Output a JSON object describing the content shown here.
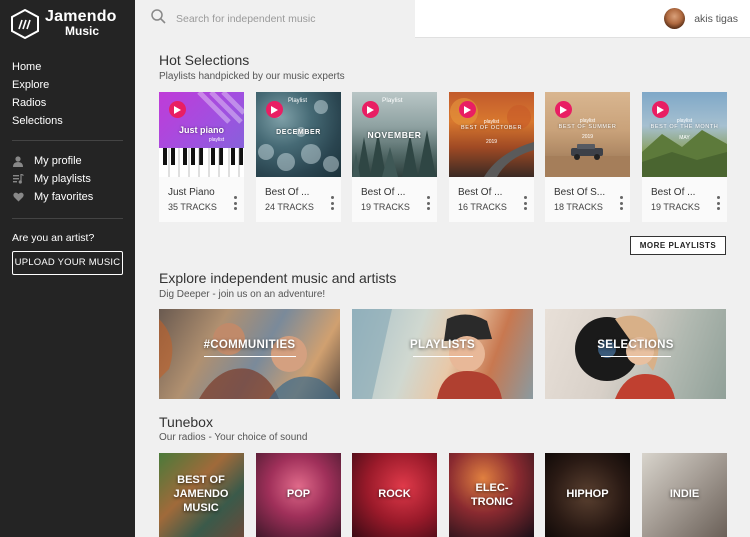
{
  "brand": {
    "line1": "Jamendo",
    "line2": "Music",
    "icon": "jamendo-logo-icon"
  },
  "nav": [
    {
      "label": "Home"
    },
    {
      "label": "Explore"
    },
    {
      "label": "Radios"
    },
    {
      "label": "Selections"
    }
  ],
  "user_nav": [
    {
      "label": "My profile",
      "icon": "person-icon"
    },
    {
      "label": "My playlists",
      "icon": "playlist-icon"
    },
    {
      "label": "My favorites",
      "icon": "heart-icon"
    }
  ],
  "artist": {
    "question": "Are you an artist?",
    "upload_label": "UPLOAD YOUR MUSIC"
  },
  "search": {
    "placeholder": "Search for independent music"
  },
  "user": {
    "name": "akis tigas"
  },
  "hot": {
    "title": "Hot Selections",
    "subtitle": "Playlists handpicked by our music experts",
    "more_label": "MORE PLAYLISTS",
    "playlists": [
      {
        "name": "Just Piano",
        "tracks": "35 TRACKS",
        "cover_top": "",
        "cover_main": "Just piano",
        "cover_sub": "playlist"
      },
      {
        "name": "Best Of ...",
        "tracks": "24 TRACKS",
        "cover_top": "Playlist",
        "cover_main": "DECEMBER",
        "cover_sub": ""
      },
      {
        "name": "Best Of ...",
        "tracks": "19 TRACKS",
        "cover_top": "Playlist",
        "cover_main": "NOVEMBER",
        "cover_sub": ""
      },
      {
        "name": "Best Of ...",
        "tracks": "16 TRACKS",
        "cover_top": "playlist",
        "cover_main": "BEST OF OCTOBER",
        "cover_sub": "2019"
      },
      {
        "name": "Best Of S...",
        "tracks": "18 TRACKS",
        "cover_top": "playlist",
        "cover_main": "BEST OF SUMMER",
        "cover_sub": "2019"
      },
      {
        "name": "Best Of ...",
        "tracks": "19 TRACKS",
        "cover_top": "playlist",
        "cover_main": "BEST OF THE MONTH",
        "cover_sub": "MAY"
      }
    ]
  },
  "explore": {
    "title": "Explore independent music and artists",
    "subtitle": "Dig Deeper - join us on an adventure!",
    "cards": [
      {
        "label": "#COMMUNITIES"
      },
      {
        "label": "PLAYLISTS"
      },
      {
        "label": "SELECTIONS"
      }
    ]
  },
  "tunebox": {
    "title": "Tunebox",
    "subtitle": "Our radios - Your choice of sound",
    "radios": [
      {
        "label": "BEST OF JAMENDO MUSIC"
      },
      {
        "label": "POP"
      },
      {
        "label": "ROCK"
      },
      {
        "label": "ELEC-TRONIC"
      },
      {
        "label": "HIPHOP"
      },
      {
        "label": "INDIE"
      }
    ]
  },
  "colors": {
    "sidebar": "#242424",
    "accent": "#e91e63",
    "background": "#f0f0f0"
  }
}
